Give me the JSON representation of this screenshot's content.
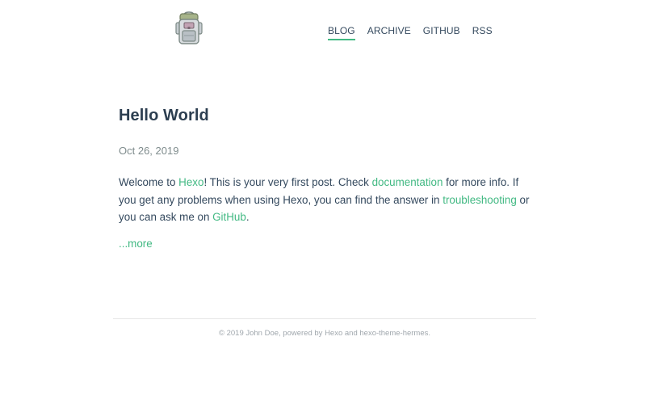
{
  "header": {
    "logo_icon": "backpack-icon",
    "nav": [
      {
        "label": "BLOG",
        "active": true
      },
      {
        "label": "ARCHIVE",
        "active": false
      },
      {
        "label": "GITHUB",
        "active": false
      },
      {
        "label": "RSS",
        "active": false
      }
    ]
  },
  "post": {
    "title": "Hello World",
    "date": "Oct 26, 2019",
    "excerpt": {
      "t1": "Welcome to ",
      "link_hexo": "Hexo",
      "t2": "! This is your very first post. Check ",
      "link_docs": "documentation",
      "t3": " for more info. If you get any problems when using Hexo, you can find the answer in ",
      "link_trouble": "troubleshooting",
      "t4": " or you can ask me on ",
      "link_github": "GitHub",
      "t5": "."
    },
    "more_label": "...more"
  },
  "footer": {
    "text": "© 2019 John Doe, powered by Hexo and hexo-theme-hermes."
  },
  "colors": {
    "accent": "#42b983",
    "text": "#34495e",
    "heading": "#2c3e50",
    "muted": "#7f8c8d"
  }
}
